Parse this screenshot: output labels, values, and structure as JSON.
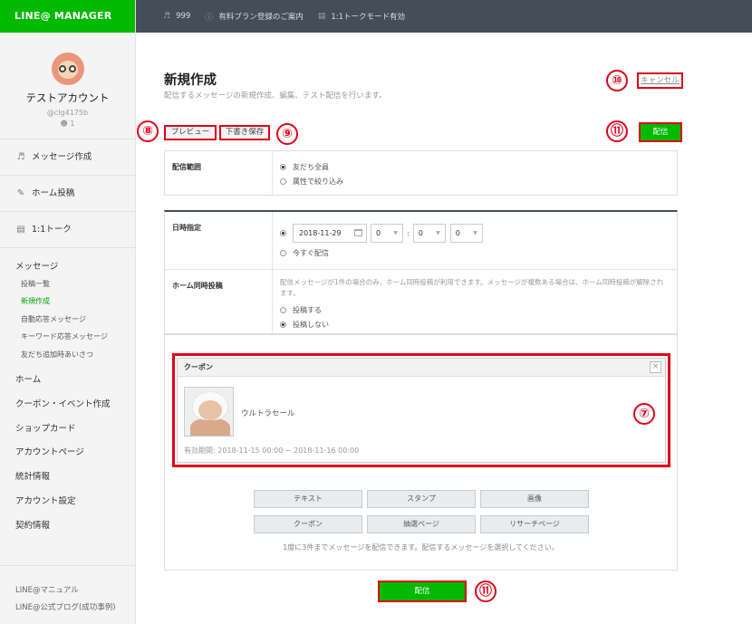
{
  "app": {
    "logo": "LINE@ MANAGER"
  },
  "topbar": {
    "items": [
      {
        "icon": "speaker-icon",
        "label": "999"
      },
      {
        "icon": "info-icon",
        "label": "有料プラン登録のご案内"
      },
      {
        "icon": "chat-icon",
        "label": "1:1トークモード有効"
      }
    ]
  },
  "account": {
    "name": "テストアカウント",
    "id": "@clg4175b",
    "friends": "1"
  },
  "sidebar": {
    "main_nav": [
      {
        "icon": "speaker-icon",
        "label": "メッセージ作成"
      },
      {
        "icon": "edit-icon",
        "label": "ホーム投稿"
      },
      {
        "icon": "chat-icon",
        "label": "1:1トーク"
      }
    ],
    "message_title": "メッセージ",
    "message_items": [
      "投稿一覧",
      "新規作成",
      "自動応答メッセージ",
      "キーワード応答メッセージ",
      "友だち追加時あいさつ"
    ],
    "active_item": "新規作成",
    "top_items": [
      "ホーム",
      "クーポン・イベント作成",
      "ショップカード",
      "アカウントページ",
      "統計情報",
      "アカウント設定",
      "契約情報"
    ],
    "footer_links": [
      "LINE@マニュアル",
      "LINE@公式ブログ(成功事例)"
    ]
  },
  "page": {
    "title": "新規作成",
    "description": "配信するメッセージの新規作成、編集、テスト配信を行います。",
    "cancel_label": "キャンセル",
    "send_label": "配信",
    "preview_label": "プレビュー",
    "draft_label": "下書き保存"
  },
  "form": {
    "scope_label": "配信範囲",
    "scope_options": [
      "友だち全員",
      "属性で絞り込み"
    ],
    "scope_selected": 0,
    "datetime_label": "日時指定",
    "date_value": "2018-11-29",
    "hour_value": "0",
    "minute_value": "0",
    "second_value": "0",
    "now_option": "今すぐ配信",
    "home_label": "ホーム同時投稿",
    "home_note": "配信メッセージが1件の場合のみ、ホーム同時投稿が利用できます。メッセージが複数ある場合は、ホーム同時投稿が解除されます。",
    "home_options": [
      "投稿する",
      "投稿しない"
    ],
    "home_selected": 1
  },
  "coupon": {
    "header": "クーポン",
    "close": "×",
    "name": "ウルトラセール",
    "period": "有効期間: 2018-11-15 00:00 ~ 2018-11-16 00:00"
  },
  "message_types": [
    "テキスト",
    "スタンプ",
    "画像",
    "クーポン",
    "抽選ページ",
    "リサーチページ"
  ],
  "limit_note": "1度に3件までメッセージを配信できます。配信するメッセージを選択してください。",
  "annotations": {
    "coupon": "⑦",
    "preview": "⑧",
    "draft": "⑨",
    "cancel": "⑩",
    "send": "⑪"
  },
  "colors": {
    "brand_green": "#00b900",
    "header_dark": "#454d58",
    "annotation_red": "#e0001a"
  }
}
